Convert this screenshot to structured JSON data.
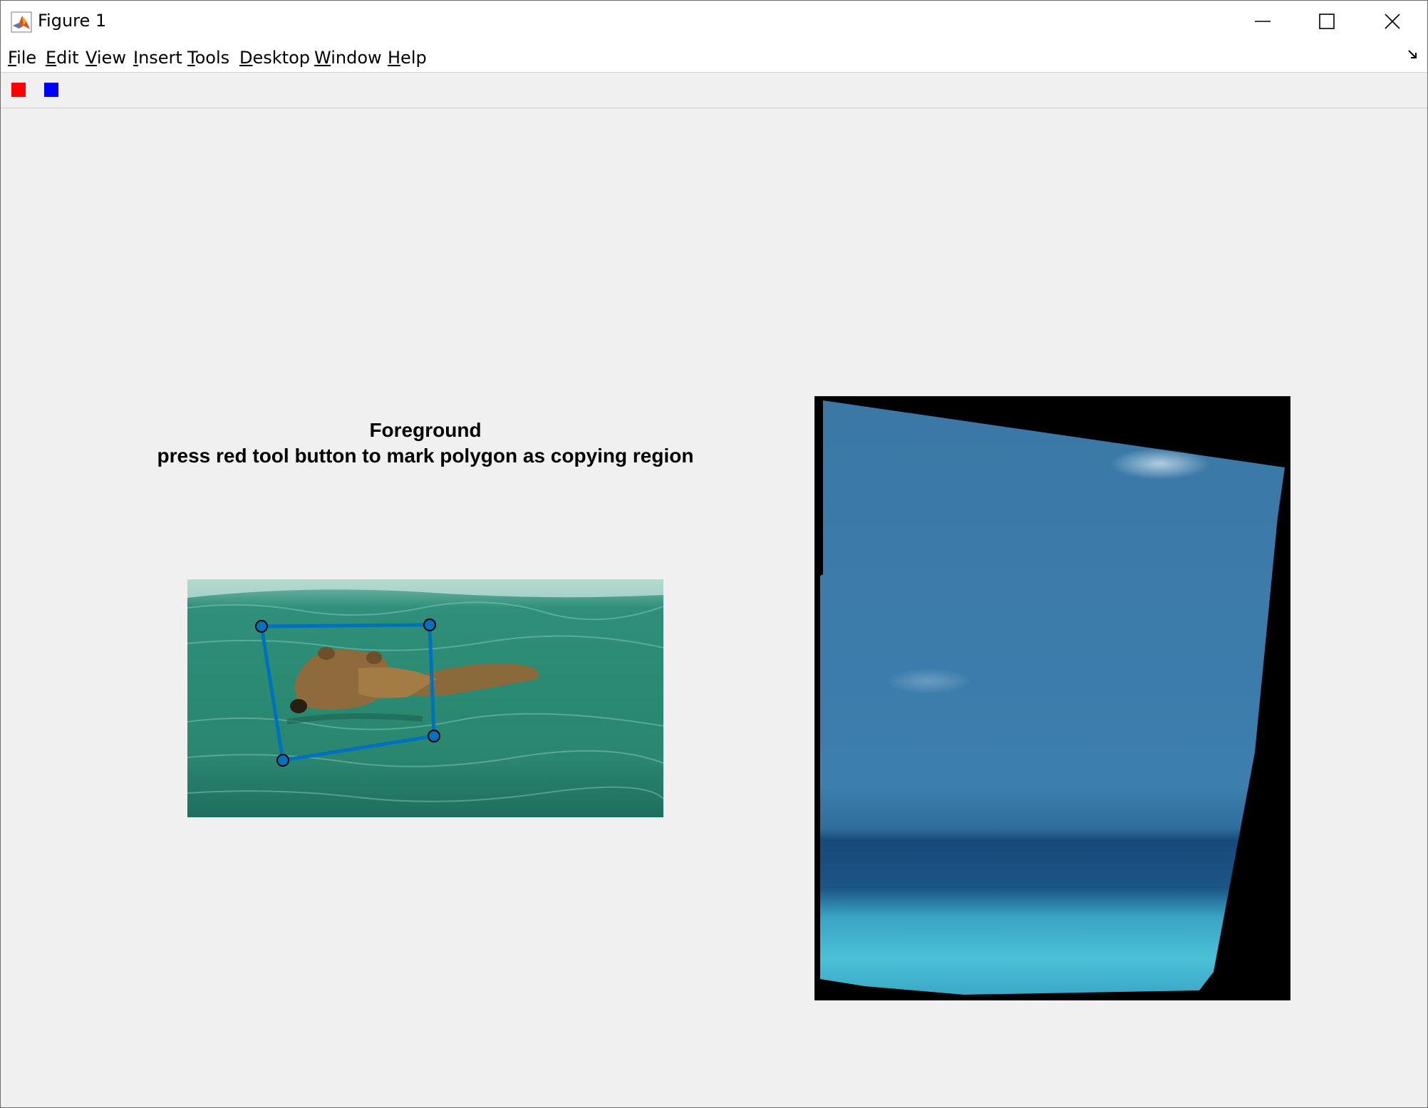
{
  "window": {
    "title": "Figure 1",
    "controls": {
      "minimize_icon": "minimize-icon",
      "maximize_icon": "maximize-icon",
      "close_icon": "close-icon"
    }
  },
  "menubar": {
    "items": [
      {
        "label": "File",
        "accel": "F",
        "rest": "ile"
      },
      {
        "label": "Edit",
        "accel": "E",
        "rest": "dit"
      },
      {
        "label": "View",
        "accel": "V",
        "rest": "iew"
      },
      {
        "label": "Insert",
        "accel": "I",
        "rest": "nsert"
      },
      {
        "label": "Tools",
        "accel": "T",
        "rest": "ools"
      },
      {
        "label": "Desktop",
        "accel": "D",
        "rest": "esktop"
      },
      {
        "label": "Window",
        "accel": "W",
        "rest": "indow"
      },
      {
        "label": "Help",
        "accel": "H",
        "rest": "elp"
      }
    ],
    "dock_icon": "dock-arrow-icon"
  },
  "toolbar": {
    "buttons": [
      {
        "name": "red-tool-button",
        "color": "#ff0000"
      },
      {
        "name": "blue-tool-button",
        "color": "#0000ff"
      }
    ]
  },
  "left_axes": {
    "title_line1": "Foreground",
    "title_line2": "press red tool button to mark polygon as copying region",
    "image": "bear swimming in green water",
    "polygon_color": "#0072bd"
  },
  "right_axes": {
    "image": "warped blue sky and sea region on black background"
  }
}
